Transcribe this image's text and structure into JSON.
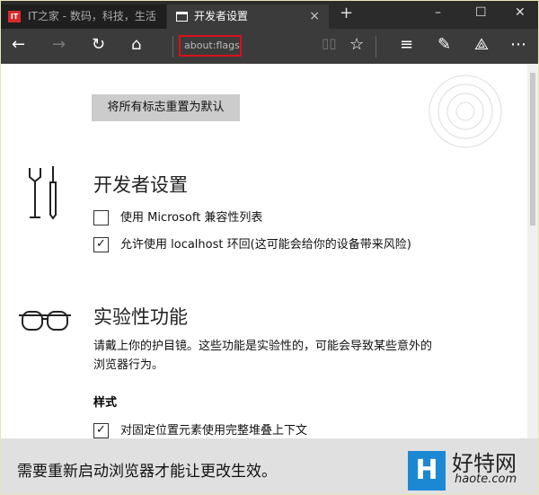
{
  "tabs": [
    {
      "label": "IT之家 - 数码，科技，生活",
      "icon": "it-logo"
    },
    {
      "label": "开发者设置",
      "close": "×"
    }
  ],
  "new_tab": "+",
  "window_controls": {
    "minimize": "–",
    "maximize": "☐",
    "close": "✕"
  },
  "address": "about:flags",
  "reset_button": "将所有标志重置为默认",
  "developer": {
    "title": "开发者设置",
    "options": [
      {
        "label": "使用 Microsoft 兼容性列表",
        "checked": false
      },
      {
        "label": "允许使用 localhost 环回(这可能会给你的设备带来风险)",
        "checked": true
      }
    ]
  },
  "experimental": {
    "title": "实验性功能",
    "description": "请戴上你的护目镜。这些功能是实验性的，可能会导致某些意外的浏览器行为。",
    "section": "样式",
    "options": [
      {
        "label": "对固定位置元素使用完整堆叠上下文",
        "checked": true
      }
    ]
  },
  "footer": {
    "message": "需要重新启动浏览器才能让更改生效。"
  },
  "watermark": {
    "logo": "H",
    "name": "好特网",
    "url": "haote.com"
  }
}
